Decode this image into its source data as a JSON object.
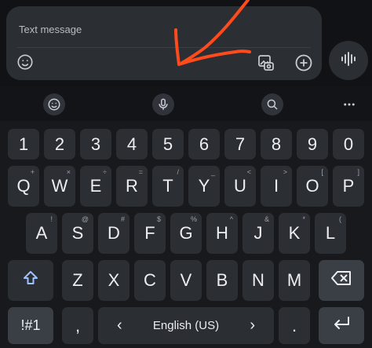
{
  "compose": {
    "placeholder": "Text message"
  },
  "icons": {
    "emoji": "emoji-icon",
    "gallery": "gallery-icon",
    "add": "add-icon",
    "voice": "voice-waveform-icon",
    "mic": "mic-icon",
    "search": "search-icon",
    "more": "more-icon",
    "shift": "shift-icon",
    "backspace": "backspace-icon",
    "enter": "enter-icon"
  },
  "keyboard": {
    "number_row": [
      "1",
      "2",
      "3",
      "4",
      "5",
      "6",
      "7",
      "8",
      "9",
      "0"
    ],
    "row1": [
      "Q",
      "W",
      "E",
      "R",
      "T",
      "Y",
      "U",
      "I",
      "O",
      "P"
    ],
    "row1_hints": [
      "+",
      "×",
      "÷",
      "=",
      "/",
      "_",
      "<",
      ">",
      "[",
      "]"
    ],
    "row2": [
      "A",
      "S",
      "D",
      "F",
      "G",
      "H",
      "J",
      "K",
      "L"
    ],
    "row2_hints": [
      "!",
      "@",
      "#",
      "$",
      "%",
      "^",
      "&",
      "*",
      "("
    ],
    "row3": [
      "Z",
      "X",
      "C",
      "V",
      "B",
      "N",
      "M"
    ],
    "symbols_label": "!#1",
    "comma": ",",
    "space_label": "English (US)",
    "period": ".",
    "space_left_arrow": "‹",
    "space_right_arrow": "›"
  },
  "colors": {
    "annotation_arrow": "#ff4a1c",
    "key_bg": "#2b2e33",
    "keyboard_bg": "#17191c"
  }
}
